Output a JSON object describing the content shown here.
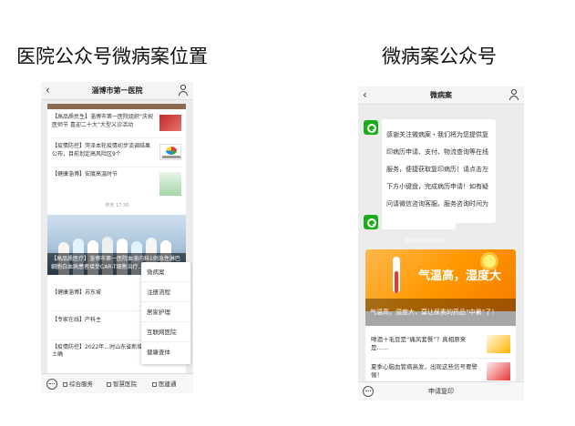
{
  "captions": {
    "left": "医院公众号微病案位置",
    "right": "微病案公众号"
  },
  "phone_left": {
    "header": {
      "title": "淄博市第一医院"
    },
    "feed": [
      {
        "text": "【高品质民生】淄博市第一医院组织“庆祝医师节 喜迎二十大”大型义诊活动"
      },
      {
        "text": "【疫情防控】菏泽本轮疫情初步流调结果公布，目前划定高风险区9个"
      },
      {
        "text": "【健康淄博】安度高温时节"
      }
    ],
    "timestamp": "昨天 17:30",
    "hero_caption": "【高品质医疗】淄博市第一医院血液内科1例急性淋巴细胞白血病患者接受CAR-T细胞治疗…",
    "articles": [
      {
        "text": "【健康淄博】苏东坡"
      },
      {
        "text": "【专家在线】产科主"
      },
      {
        "text": "【疫情防控】2022年…时山东省新增本土确"
      }
    ],
    "menu": [
      "微病案",
      "注册流程",
      "居家护理",
      "互联网医院",
      "健康查体"
    ],
    "bottom_tabs": [
      "综合服务",
      "智慧医院",
      "医建通"
    ]
  },
  "phone_right": {
    "header": {
      "title": "微病案"
    },
    "message": "感谢关注微病案・我们将为您提供复印病历申请、支付、物流查询等在线服务，便捷获取复印病历！请点击左下方小键盘，完成病历申请！如有疑问请微信咨询客服。服务咨询时间为工作日：8:30-17:30。",
    "card": {
      "banner_title": "气温高，湿度大",
      "headline": "气温高，湿度大，莫让尿素的药品“中暑”了！",
      "items": [
        {
          "text": "啤酒＋毛豆是“痛风套餐”？真相原来是……"
        },
        {
          "text": "夏季心脑血管病高发，出现这些信号要警惕！"
        }
      ]
    },
    "bottom_label": "申请复印"
  }
}
